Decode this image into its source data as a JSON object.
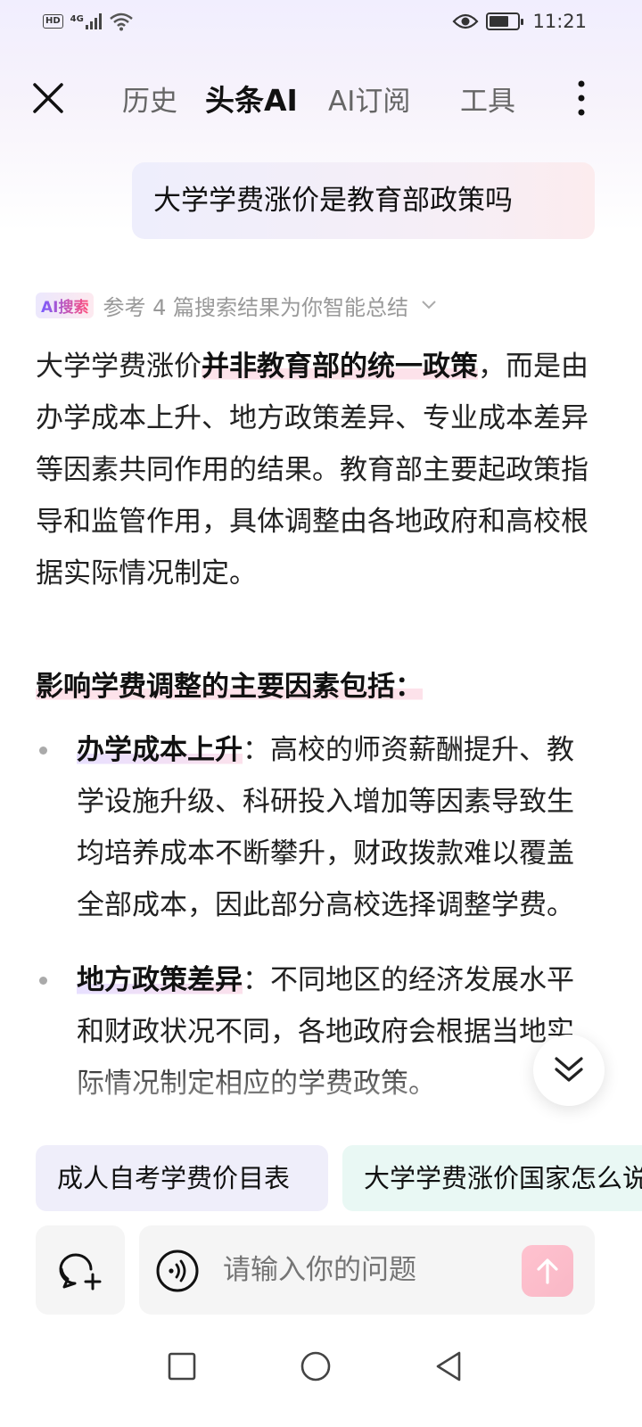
{
  "status_bar": {
    "hd": "HD",
    "network": "4G",
    "time": "11:21",
    "icons": [
      "signal-icon",
      "wifi-icon",
      "eye-icon",
      "battery-icon"
    ]
  },
  "nav": {
    "tabs": [
      {
        "label": "历史",
        "active": false
      },
      {
        "label": "头条AI",
        "active": true
      },
      {
        "label": "AI订阅",
        "active": false
      },
      {
        "label": "工具",
        "active": false
      }
    ]
  },
  "question": "大学学费涨价是教育部政策吗",
  "ai_search": {
    "badge": "AI搜索",
    "summary": "参考 4 篇搜索结果为你智能总结"
  },
  "answer": {
    "p1_prefix": "大学学费涨价",
    "p1_highlight": "并非教育部的统一政策",
    "p1_rest": "，而是由办学成本上升、地方政策差异、专业成本差异等因素共同作用的结果。教育部主要起政策指导和监管作用，具体调整由各地政府和高校根据实际情况制定。",
    "heading": "影响学费调整的主要因素包括：",
    "items": [
      {
        "title": "办学成本上升",
        "text": "：高校的师资薪酬提升、教学设施升级、科研投入增加等因素导致生均培养成本不断攀升，财政拨款难以覆盖全部成本，因此部分高校选择调整学费。"
      },
      {
        "title": "地方政策差异",
        "text": "：不同地区的经济发展水平和财政状况不同，各地政府会根据当地实际情况制定相应的学费政策。"
      }
    ]
  },
  "suggestions": [
    "成人自考学费价目表",
    "大学学费涨价国家怎么说"
  ],
  "input": {
    "placeholder": "请输入你的问题"
  },
  "colors": {
    "accent_purple": "#7a5cff",
    "accent_pink": "#ff4f7b",
    "chip_purple": "#efeefa",
    "chip_green": "#e9f8f4"
  }
}
